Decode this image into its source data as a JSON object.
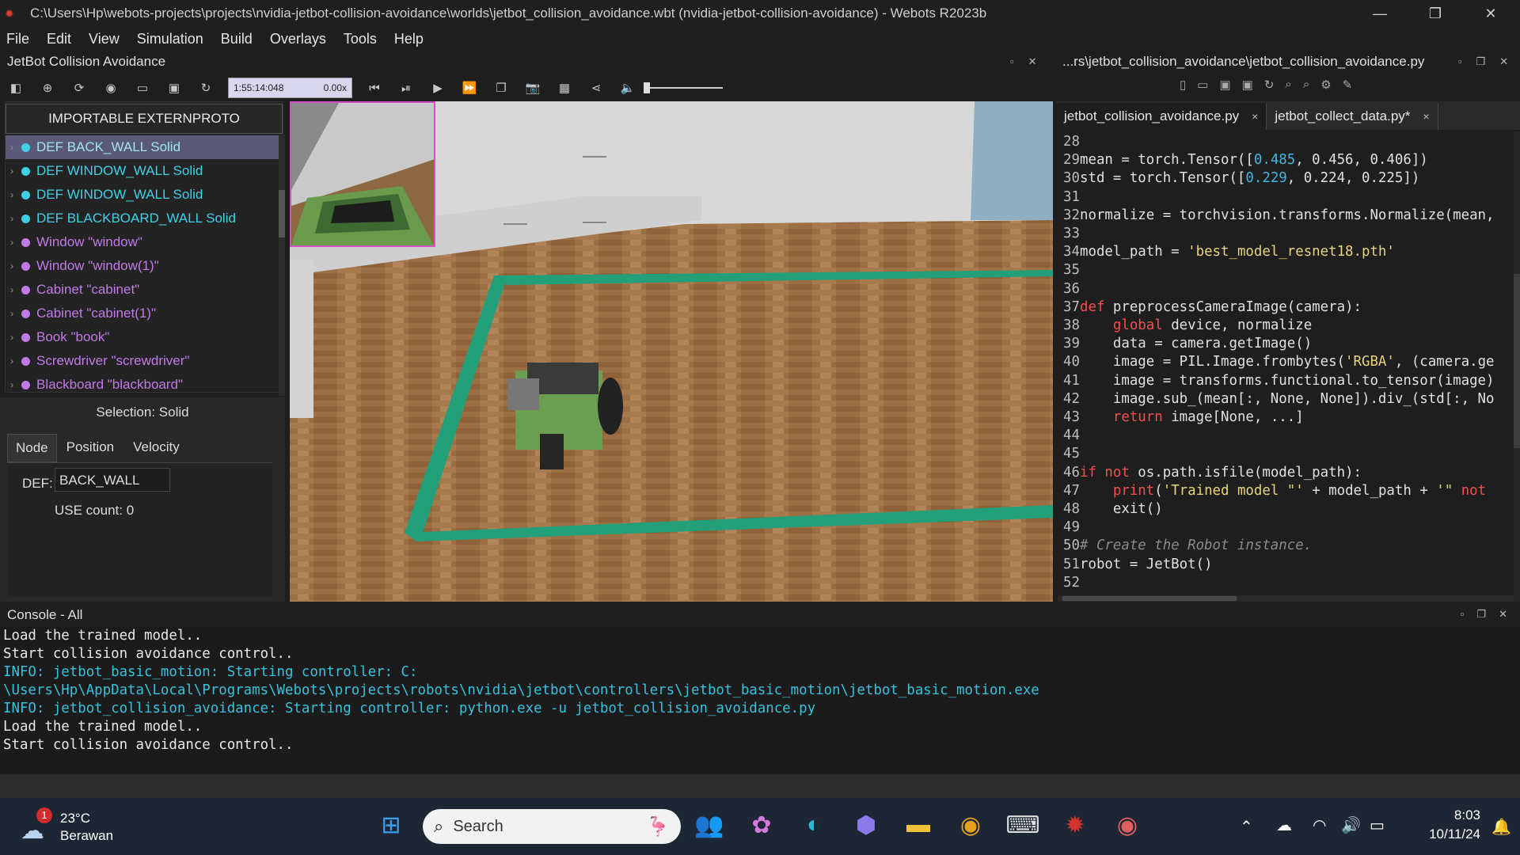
{
  "window": {
    "title": "C:\\Users\\Hp\\webots-projects\\projects\\nvidia-jetbot-collision-avoidance\\worlds\\jetbot_collision_avoidance.wbt (nvidia-jetbot-collision-avoidance) - Webots R2023b",
    "minimize": "—",
    "restore": "❐",
    "close": "✕"
  },
  "menu": [
    "File",
    "Edit",
    "View",
    "Simulation",
    "Build",
    "Overlays",
    "Tools",
    "Help"
  ],
  "left_panel": {
    "title": "JetBot Collision Avoidance",
    "sim_time": "1:55:14:048",
    "sim_speed": "0.00x",
    "scene_tree_header": "IMPORTABLE EXTERNPROTO",
    "tree_items": [
      {
        "label": "DEF BACK_WALL Solid",
        "color": "#3fd0e8",
        "text_color": "#9fe4f0",
        "selected": true
      },
      {
        "label": "DEF WINDOW_WALL Solid",
        "color": "#3fd0e8",
        "text_color": "#3fd0e8",
        "selected": false
      },
      {
        "label": "DEF WINDOW_WALL Solid",
        "color": "#3fd0e8",
        "text_color": "#3fd0e8",
        "selected": false
      },
      {
        "label": "DEF BLACKBOARD_WALL Solid",
        "color": "#3fd0e8",
        "text_color": "#3fd0e8",
        "selected": false
      },
      {
        "label": "Window \"window\"",
        "color": "#c27ae8",
        "text_color": "#c27ae8",
        "selected": false
      },
      {
        "label": "Window \"window(1)\"",
        "color": "#c27ae8",
        "text_color": "#c27ae8",
        "selected": false
      },
      {
        "label": "Cabinet \"cabinet\"",
        "color": "#c27ae8",
        "text_color": "#c27ae8",
        "selected": false
      },
      {
        "label": "Cabinet \"cabinet(1)\"",
        "color": "#c27ae8",
        "text_color": "#c27ae8",
        "selected": false
      },
      {
        "label": "Book \"book\"",
        "color": "#c27ae8",
        "text_color": "#c27ae8",
        "selected": false
      },
      {
        "label": "Screwdriver \"screwdriver\"",
        "color": "#c27ae8",
        "text_color": "#c27ae8",
        "selected": false
      },
      {
        "label": "Blackboard \"blackboard\"",
        "color": "#c27ae8",
        "text_color": "#c27ae8",
        "selected": false
      }
    ],
    "selection_title": "Selection: Solid",
    "tabs": [
      "Node",
      "Position",
      "Velocity"
    ],
    "def_label": "DEF:",
    "def_value": "BACK_WALL",
    "use_count": "USE count: 0"
  },
  "editor": {
    "title": "...rs\\jetbot_collision_avoidance\\jetbot_collision_avoidance.py",
    "tabs": [
      {
        "label": "jetbot_collision_avoidance.py",
        "close": "×"
      },
      {
        "label": "jetbot_collect_data.py*",
        "close": "×"
      }
    ],
    "lines": [
      {
        "n": "28",
        "html": ""
      },
      {
        "n": "29",
        "html": "mean = torch.Tensor([<span class='num'>0.485</span>, 0.456, 0.406])"
      },
      {
        "n": "30",
        "html": "std = torch.Tensor([<span class='num'>0.229</span>, 0.224, 0.225])"
      },
      {
        "n": "31",
        "html": ""
      },
      {
        "n": "32",
        "html": "normalize = torchvision.transforms.Normalize(mean,"
      },
      {
        "n": "33",
        "html": ""
      },
      {
        "n": "34",
        "html": "model_path = <span class='str'>'best_model_resnet18.pth'</span>"
      },
      {
        "n": "35",
        "html": ""
      },
      {
        "n": "36",
        "html": ""
      },
      {
        "n": "37",
        "html": "<span class='kw'>def</span> preprocessCameraImage(camera):"
      },
      {
        "n": "38",
        "html": "    <span class='kw'>global</span> device, normalize"
      },
      {
        "n": "39",
        "html": "    data = camera.getImage()"
      },
      {
        "n": "40",
        "html": "    image = PIL.Image.frombytes(<span class='str'>'RGBA'</span>, (camera.ge"
      },
      {
        "n": "41",
        "html": "    image = transforms.functional.to_tensor(image)"
      },
      {
        "n": "42",
        "html": "    image.sub_(mean[:, None, None]).div_(std[:, No"
      },
      {
        "n": "43",
        "html": "    <span class='kw'>return</span> image[None, ...]"
      },
      {
        "n": "44",
        "html": ""
      },
      {
        "n": "45",
        "html": ""
      },
      {
        "n": "46",
        "html": "<span class='kw'>if not</span> os.path.isfile(model_path):"
      },
      {
        "n": "47",
        "html": "    <span class='kw'>print</span>(<span class='str'>'Trained model \"'</span> + model_path + <span class='str'>'\" </span><span class='kw'>not</span>"
      },
      {
        "n": "48",
        "html": "    exit()"
      },
      {
        "n": "49",
        "html": ""
      },
      {
        "n": "50",
        "html": "<span class='cm'># Create the Robot instance.</span>"
      },
      {
        "n": "51",
        "html": "robot = JetBot()"
      },
      {
        "n": "52",
        "html": ""
      }
    ]
  },
  "console": {
    "title": "Console - All",
    "lines": [
      {
        "text": "Load the trained model..",
        "type": "plain"
      },
      {
        "text": "Start collision avoidance control..",
        "type": "plain"
      },
      {
        "text": "INFO: jetbot_basic_motion: Starting controller: C:",
        "type": "info"
      },
      {
        "text": "\\Users\\Hp\\AppData\\Local\\Programs\\Webots\\projects\\robots\\nvidia\\jetbot\\controllers\\jetbot_basic_motion\\jetbot_basic_motion.exe",
        "type": "info"
      },
      {
        "text": "INFO: jetbot_collision_avoidance: Starting controller: python.exe -u jetbot_collision_avoidance.py",
        "type": "info"
      },
      {
        "text": "Load the trained model..",
        "type": "plain"
      },
      {
        "text": "Start collision avoidance control..",
        "type": "plain"
      }
    ]
  },
  "taskbar": {
    "weather_temp": "23°C",
    "weather_desc": "Berawan",
    "weather_badge": "1",
    "search_placeholder": "Search",
    "time": "8:03",
    "date": "10/11/24"
  }
}
